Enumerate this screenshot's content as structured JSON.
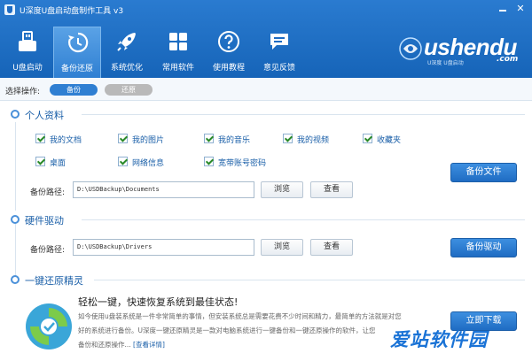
{
  "window": {
    "title": "U深度U盘启动盘制作工具 v3",
    "minimize_glyph": "",
    "close_glyph": "✕"
  },
  "nav": {
    "items": [
      {
        "label": "U盘启动",
        "icon": "usb-drive-icon"
      },
      {
        "label": "备份还原",
        "icon": "clock-restore-icon",
        "active": true
      },
      {
        "label": "系统优化",
        "icon": "rocket-icon"
      },
      {
        "label": "常用软件",
        "icon": "apps-grid-icon"
      },
      {
        "label": "使用教程",
        "icon": "help-icon"
      },
      {
        "label": "意见反馈",
        "icon": "feedback-icon"
      }
    ]
  },
  "brand": {
    "name": "ushendu",
    "sub": "U深度 U盘启动",
    "suffix": ".com"
  },
  "action_bar": {
    "label": "选择操作:",
    "backup_label": "备份",
    "restore_label": "还原"
  },
  "personal": {
    "title": "个人资料",
    "checkboxes": [
      {
        "label": "我的文档",
        "checked": true
      },
      {
        "label": "我的图片",
        "checked": true
      },
      {
        "label": "我的音乐",
        "checked": true
      },
      {
        "label": "我的视频",
        "checked": true
      },
      {
        "label": "收藏夹",
        "checked": true
      },
      {
        "label": "桌面",
        "checked": true
      },
      {
        "label": "网络信息",
        "checked": true
      },
      {
        "label": "宽带账号密码",
        "checked": true
      }
    ],
    "path_label": "备份路径:",
    "path_value": "D:\\USDBackup\\Documents",
    "browse_label": "浏览",
    "view_label": "查看",
    "action_label": "备份文件"
  },
  "hardware": {
    "title": "硬件驱动",
    "path_label": "备份路径:",
    "path_value": "D:\\USDBackup\\Drivers",
    "browse_label": "浏览",
    "view_label": "查看",
    "action_label": "备份驱动"
  },
  "restore_wizard": {
    "title": "一键还原精灵",
    "headline": "轻松一键，快速恢复系统到最佳状态!",
    "line1": "如今使用u盘装系统是一件非常简单的事情，但安装系统总是需要花费不少时间和精力，最简单的方法就是对您",
    "line2": "好的系统进行备份。U深度一键还原精灵是一款对电脑系统进行一键备份和一键还原操作的软件，让您",
    "line3": "备份和还原操作...",
    "more_link": "[查看详情]",
    "download_label": "立即下载"
  },
  "watermark": {
    "text": "爱站软件园"
  },
  "colors": {
    "header_blue": "#1f6cc3",
    "accent": "#1a5fa8",
    "check_green": "#2a8a2a"
  }
}
